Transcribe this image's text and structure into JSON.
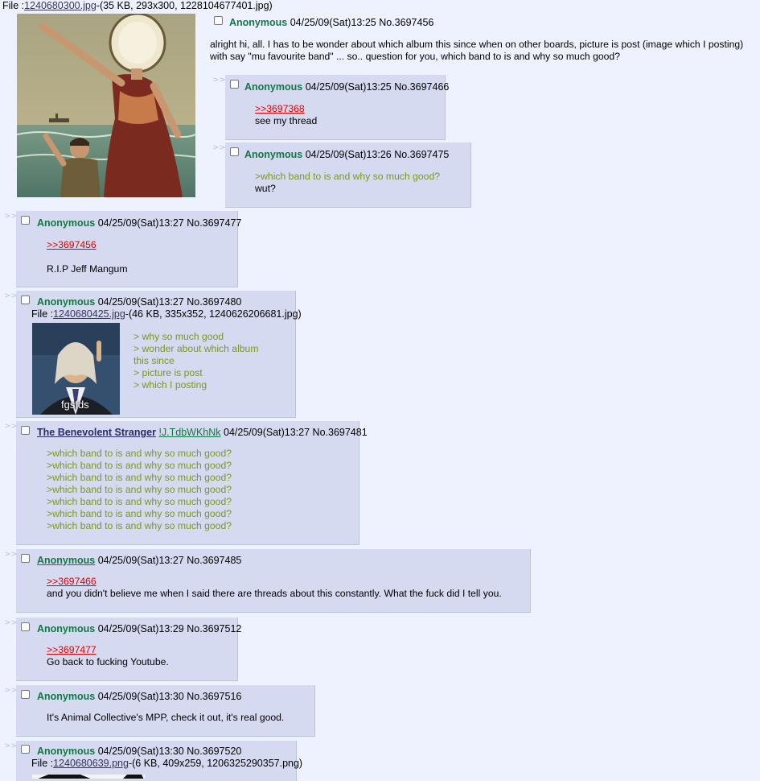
{
  "op": {
    "file_prefix": "File :",
    "file_link": "1240680300.jpg",
    "file_info": "-(35 KB, 293x300, 1228104677401.jpg)",
    "name": "Anonymous",
    "datetime": "04/25/09(Sat)13:25",
    "postno": "No.3697456",
    "body1": "alright hi, all. I has to be wonder about which album this since when on other boards, picture is post (image which I posting)",
    "body2": "with say \"mu favourite band\" ... so.. question for you, which band to is and why so much good?"
  },
  "arrows": ">>",
  "replies": [
    {
      "name": "Anonymous",
      "datetime": "04/25/09(Sat)13:25",
      "postno": "No.3697466",
      "link": ">>3697368",
      "text": "see my thread"
    },
    {
      "name": "Anonymous",
      "datetime": "04/25/09(Sat)13:26",
      "postno": "No.3697475",
      "quote": ">which band to is and why so much good?",
      "text": "wut?"
    },
    {
      "name": "Anonymous",
      "datetime": "04/25/09(Sat)13:27",
      "postno": "No.3697477",
      "link": ">>3697456",
      "text": "R.I.P Jeff Mangum"
    },
    {
      "name": "Anonymous",
      "datetime": "04/25/09(Sat)13:27",
      "postno": "No.3697480",
      "file_prefix": "File :",
      "file_link": "1240680425.jpg",
      "file_info": "-(46 KB, 335x352, 1240626206681.jpg)",
      "image_caption": "fgsfds",
      "lines": [
        "> why so much good",
        "> wonder about which album",
        "this since",
        "> picture is post",
        "> which I posting"
      ]
    },
    {
      "name": "The Benevolent Stranger",
      "trip": "!J.TdbWKhNk",
      "datetime": "04/25/09(Sat)13:27",
      "postno": "No.3697481",
      "lines": [
        ">which band to is and why so much good?",
        ">which band to is and why so much good?",
        ">which band to is and why so much good?",
        ">which band to is and why so much good?",
        ">which band to is and why so much good?",
        ">which band to is and why so much good?",
        ">which band to is and why so much good?"
      ]
    },
    {
      "name": "Anonymous",
      "datetime": "04/25/09(Sat)13:27",
      "postno": "No.3697485",
      "link": ">>3697466",
      "text": "and you didn't believe me when I said there are threads about this constantly. What the fuck did I tell you."
    },
    {
      "name": "Anonymous",
      "datetime": "04/25/09(Sat)13:29",
      "postno": "No.3697512",
      "link": ">>3697477",
      "text": "Go back to fucking Youtube."
    },
    {
      "name": "Anonymous",
      "datetime": "04/25/09(Sat)13:30",
      "postno": "No.3697516",
      "text": "It's Animal Collective's MPP, check it out, it's real good."
    },
    {
      "name": "Anonymous",
      "datetime": "04/25/09(Sat)13:30",
      "postno": "No.3697520",
      "file_prefix": "File :",
      "file_link": "1240680639.png",
      "file_info": "-(6 KB, 409x259, 1206325290357.png)"
    }
  ]
}
